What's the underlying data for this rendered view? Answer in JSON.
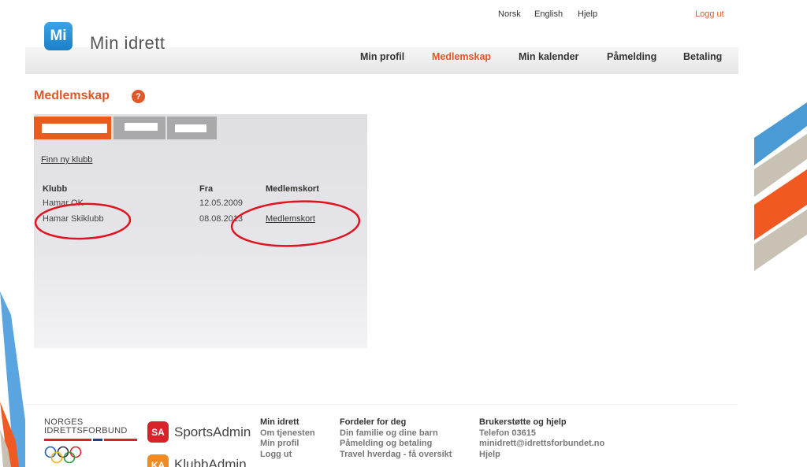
{
  "header": {
    "app_name": "Min idrett",
    "logo_letters": "Mi",
    "lang_links": [
      "Norsk",
      "English",
      "Hjelp"
    ],
    "logout": "Logg ut",
    "nav": [
      "Min profil",
      "Medlemskap",
      "Min kalender",
      "Påmelding",
      "Betaling"
    ],
    "active_nav": "Medlemskap"
  },
  "main": {
    "title": "Medlemskap",
    "help_glyph": "?",
    "find_club_link": "Finn ny klubb",
    "columns": [
      "Klubb",
      "Fra",
      "Medlemskort"
    ],
    "rows": [
      {
        "klubb": "Hamar OK",
        "fra": "12.05.2009",
        "kort": ""
      },
      {
        "klubb": "Hamar Skiklubb",
        "fra": "08.08.2013",
        "kort": "Medlemskort"
      }
    ]
  },
  "footer": {
    "nif_line1": "NORGES",
    "nif_line2": "IDRETTSFORBUND",
    "sportsadmin": "SportsAdmin",
    "sportsadmin_badge": "SA",
    "klubbadmin": "KlubbAdmin",
    "klubbadmin_badge": "KA",
    "col1": {
      "heading": "Min idrett",
      "items": [
        "Om tjenesten",
        "Min profil",
        "Logg ut"
      ]
    },
    "col2": {
      "heading": "Fordeler for deg",
      "items": [
        "Din familie og dine barn",
        "Påmelding og betaling",
        "Travel hverdag - få oversikt"
      ]
    },
    "col3": {
      "heading": "Brukerstøtte og hjelp",
      "items": [
        "Telefon 03615",
        "minidrett@idrettsforbundet.no",
        "Hjelp"
      ]
    }
  },
  "colors": {
    "accent": "#e0582a",
    "tab_active": "#e95b1e",
    "tab_inactive": "#a9a9ab",
    "annotation_red": "#e0141e"
  }
}
